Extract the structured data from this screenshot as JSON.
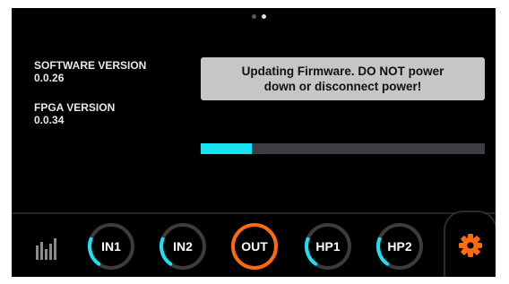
{
  "pager": {
    "pages": 2,
    "active_index": 1
  },
  "info": {
    "software_label": "SOFTWARE VERSION",
    "software_value": "0.0.26",
    "fpga_label": "FPGA VERSION",
    "fpga_value": "0.0.34"
  },
  "alert": {
    "message": "Updating Firmware. DO NOT power\ndown or disconnect power!"
  },
  "progress": {
    "fraction": 0.18
  },
  "nav": {
    "channels": [
      {
        "label": "IN1",
        "selected": false
      },
      {
        "label": "IN2",
        "selected": false
      },
      {
        "label": "OUT",
        "selected": true
      },
      {
        "label": "HP1",
        "selected": false
      },
      {
        "label": "HP2",
        "selected": false
      }
    ],
    "meter_icon": "level-meter-icon",
    "settings_icon": "gear-icon"
  },
  "colors": {
    "accent_cyan": "#19e3f0",
    "accent_orange": "#ff6a10",
    "ring_track": "#3c3c3c",
    "alert_bg": "#c6c6c6"
  }
}
